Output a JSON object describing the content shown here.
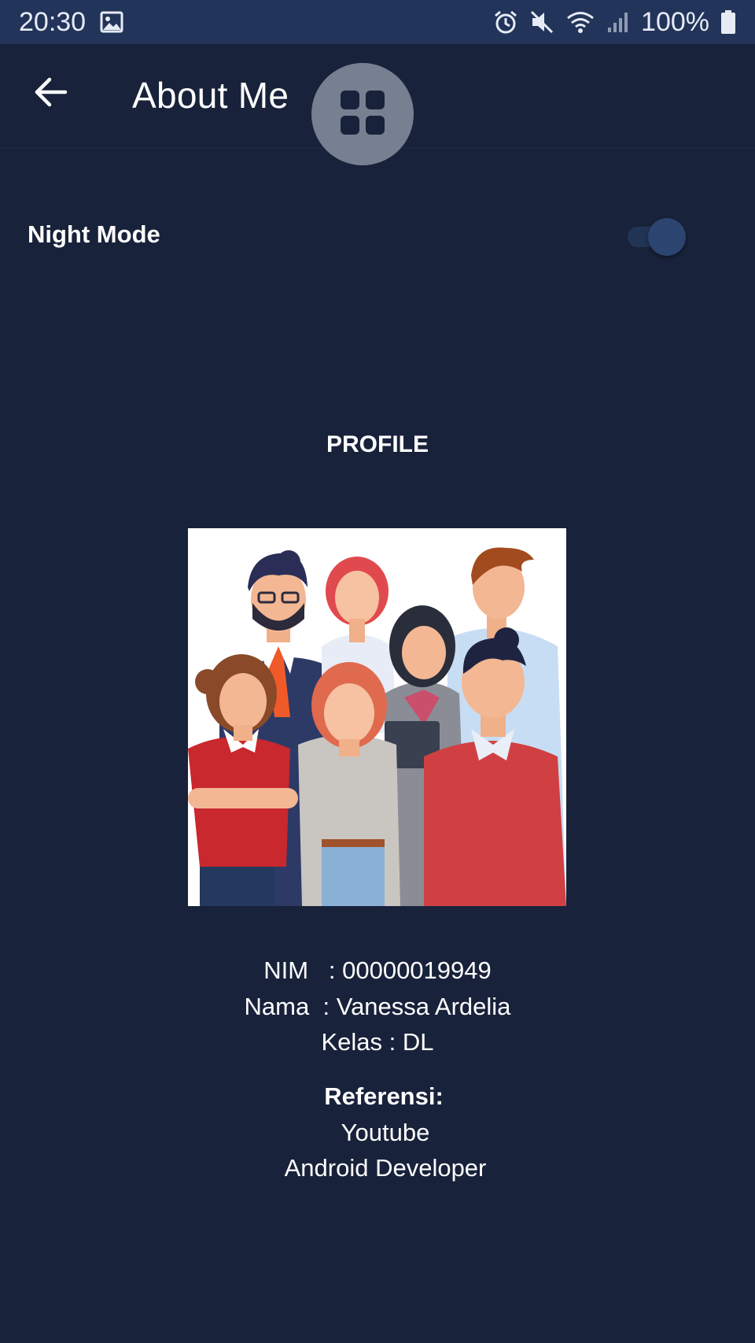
{
  "status_bar": {
    "time": "20:30",
    "battery": "100%",
    "icons": [
      "image-icon",
      "alarm-icon",
      "mute-icon",
      "wifi-icon",
      "signal-icon",
      "battery-icon"
    ]
  },
  "app_bar": {
    "title": "About Me",
    "back_icon": "arrow-left-icon",
    "floating_icon": "grid-icon"
  },
  "settings": {
    "night_mode_label": "Night Mode",
    "night_mode_on": true
  },
  "profile": {
    "heading": "PROFILE",
    "image": "team-illustration",
    "nim": "NIM   : 00000019949",
    "nama": "Nama  : Vanessa Ardelia",
    "kelas": "Kelas : DL"
  },
  "references": {
    "title": "Referensi:",
    "items": [
      "Youtube",
      "Android Developer"
    ]
  },
  "colors": {
    "background": "#18223a",
    "status_bar": "#223459",
    "switch_thumb": "#2c4570"
  }
}
